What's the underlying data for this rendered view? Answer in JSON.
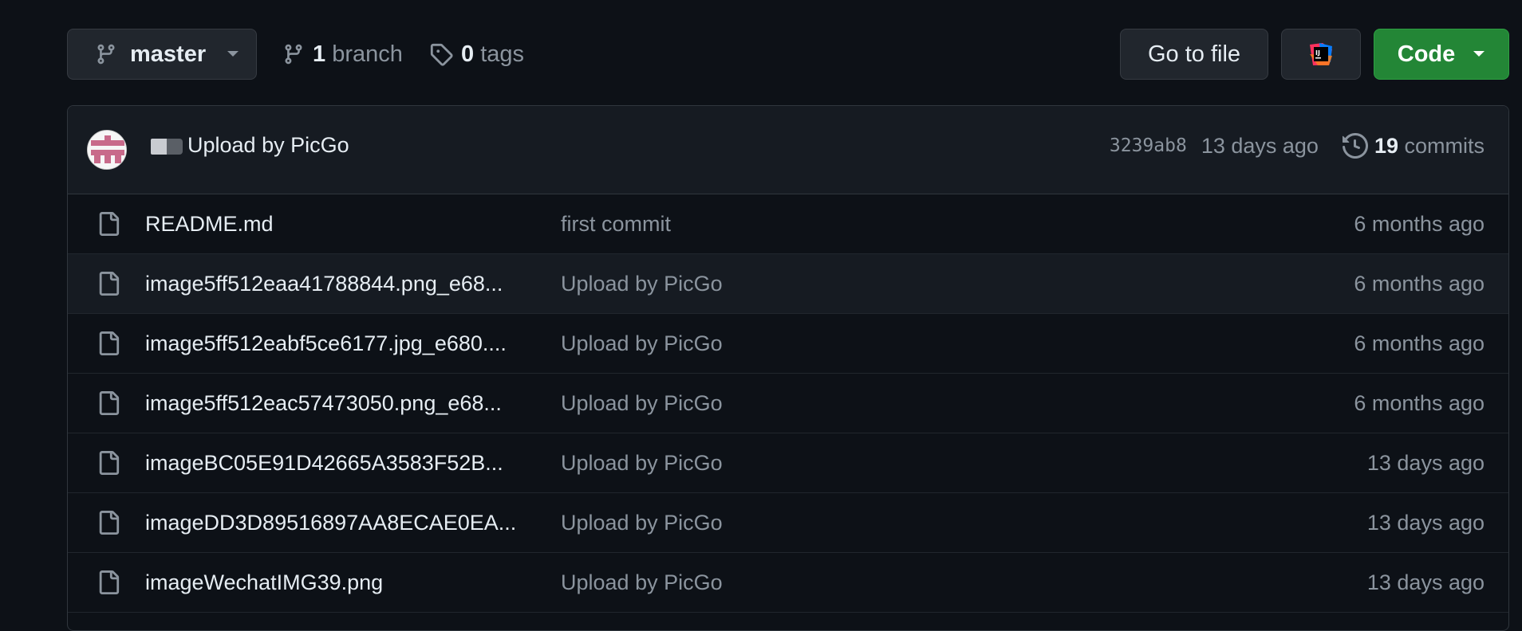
{
  "toolbar": {
    "branch_name": "master",
    "branch_count": "1",
    "branch_label": "branch",
    "tag_count": "0",
    "tag_label": "tags",
    "go_to_file": "Go to file",
    "ide_label": "IJ",
    "code_label": "Code"
  },
  "latest_commit": {
    "message": "Upload by PicGo",
    "sha": "3239ab8",
    "age": "13 days ago",
    "commit_count": "19",
    "commit_label": "commits"
  },
  "files": [
    {
      "name": "README.md",
      "message": "first commit",
      "age": "6 months ago"
    },
    {
      "name": "image5ff512eaa41788844.png_e68...",
      "message": "Upload by PicGo",
      "age": "6 months ago"
    },
    {
      "name": "image5ff512eabf5ce6177.jpg_e680....",
      "message": "Upload by PicGo",
      "age": "6 months ago"
    },
    {
      "name": "image5ff512eac57473050.png_e68...",
      "message": "Upload by PicGo",
      "age": "6 months ago"
    },
    {
      "name": "imageBC05E91D42665A3583F52B...",
      "message": "Upload by PicGo",
      "age": "13 days ago"
    },
    {
      "name": "imageDD3D89516897AA8ECAE0EA...",
      "message": "Upload by PicGo",
      "age": "13 days ago"
    },
    {
      "name": "imageWechatIMG39.png",
      "message": "Upload by PicGo",
      "age": "13 days ago"
    }
  ],
  "colors": {
    "background": "#0d1117",
    "code_button": "#238636",
    "muted_text": "#8b949e"
  }
}
